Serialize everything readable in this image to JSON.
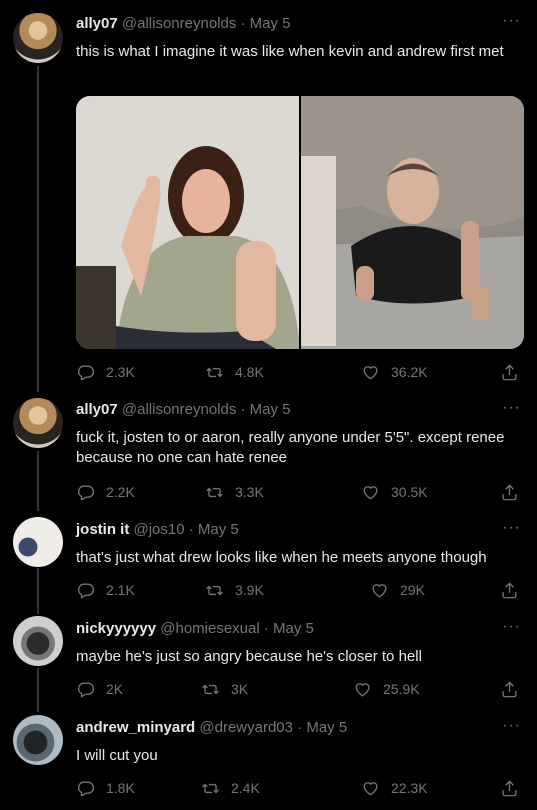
{
  "tweets": [
    {
      "name": "ally07",
      "handle": "@allisonreynolds",
      "date": "· May 5",
      "text": "this is what I imagine it was like when kevin and andrew first met",
      "replies": "2.3K",
      "retweets": "4.8K",
      "likes": "36.2K"
    },
    {
      "name": "ally07",
      "handle": "@allisonreynolds",
      "date": "· May 5",
      "text": "fuck it, josten to or aaron, really anyone under 5'5\". except renee because no one can hate renee",
      "replies": "2.2K",
      "retweets": "3.3K",
      "likes": "30.5K"
    },
    {
      "name": "jostin it",
      "handle": "@jos10",
      "date": "· May 5",
      "text": "that's just what drew looks like when he meets anyone though",
      "replies": "2.1K",
      "retweets": "3.9K",
      "likes": "29K"
    },
    {
      "name": "nickyyyyyy",
      "handle": "@homiesexual",
      "date": "· May 5",
      "text": "maybe he's just so angry because he's closer to hell",
      "replies": "2K",
      "retweets": "3K",
      "likes": "25.9K"
    },
    {
      "name": "andrew_minyard",
      "handle": "@drewyard03",
      "date": "· May 5",
      "text": "I will cut you",
      "replies": "1.8K",
      "retweets": "2.4K",
      "likes": "22.3K"
    }
  ],
  "more_glyph": "···",
  "icons": {
    "reply": "reply-icon",
    "retweet": "retweet-icon",
    "like": "heart-icon",
    "share": "share-icon"
  },
  "colors": {
    "background": "#000000",
    "text": "#e7e9ea",
    "muted": "#71767b",
    "line": "#333639"
  }
}
